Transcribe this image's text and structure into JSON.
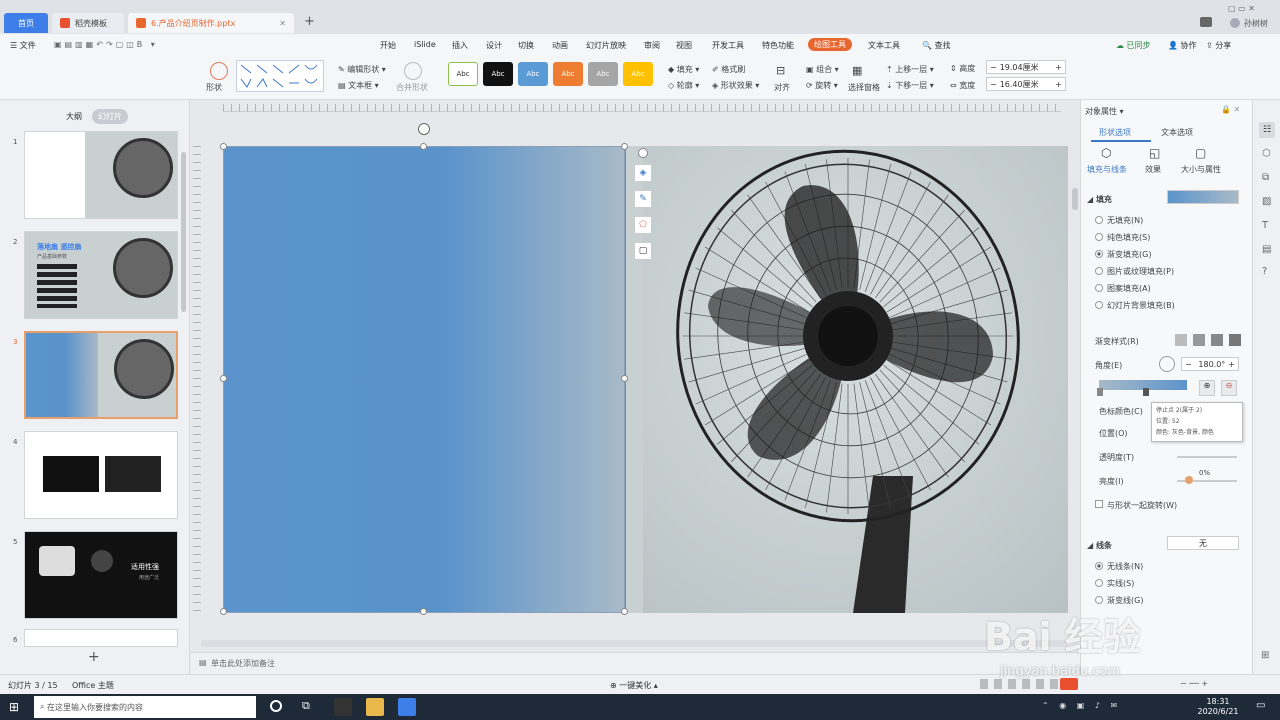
{
  "tabs": {
    "home": "首页",
    "templates": "稻壳模板",
    "document": "6.产品介绍页制作.pptx",
    "user": "孙树树"
  },
  "menu": {
    "file": "文件",
    "items": [
      "开始",
      "iSlide",
      "插入",
      "设计",
      "切换",
      "动画",
      "幻灯片放映",
      "审阅",
      "视图",
      "开发工具",
      "特色功能",
      "绘图工具",
      "文本工具"
    ],
    "active_index": 11,
    "search": "查找",
    "sync": "已同步",
    "collab": "协作",
    "share": "分享"
  },
  "ribbon": {
    "shape_label": "形状",
    "edit_shape": "编辑形状",
    "text_box": "文本框",
    "merge_shape": "合并形状",
    "style_label": "Abc",
    "fill": "填充",
    "format_brush": "格式刷",
    "outline": "轮廓",
    "shape_effect": "形状效果",
    "align": "对齐",
    "group": "组合",
    "rotate": "旋转",
    "select_pane": "选择窗格",
    "up_layer": "上移一层",
    "down_layer": "下移一层",
    "height_label": "高度",
    "width_label": "宽度",
    "height_value": "19.04厘米",
    "width_value": "16.40厘米"
  },
  "styles": [
    {
      "bg": "#ffffff",
      "fg": "#333333",
      "border": "#8bc34a"
    },
    {
      "bg": "#111111",
      "fg": "#ffffff",
      "border": "#111111"
    },
    {
      "bg": "#5b9bd5",
      "fg": "#ffffff",
      "border": "#5b9bd5"
    },
    {
      "bg": "#ed7d31",
      "fg": "#ffffff",
      "border": "#ed7d31"
    },
    {
      "bg": "#a5a5a5",
      "fg": "#ffffff",
      "border": "#a5a5a5"
    },
    {
      "bg": "#ffc000",
      "fg": "#ffffff",
      "border": "#ffc000"
    }
  ],
  "left": {
    "outline_tab": "大纲",
    "slides_tab": "幻灯片",
    "nums": [
      "1",
      "2",
      "3",
      "4",
      "5",
      "6"
    ]
  },
  "thumb2": {
    "title1": "落地扇",
    "title2": "遥控扇",
    "sub": "产品基础参数"
  },
  "thumb5": {
    "title": "适用性强",
    "sub": "用途广泛"
  },
  "notes": "单击此处添加备注",
  "panel": {
    "title": "对象属性",
    "tab_shape": "形状选项",
    "tab_text": "文本选项",
    "sub_fill": "填充与线条",
    "sub_effect": "效果",
    "sub_size": "大小与属性",
    "fill_section": "填充",
    "fill_options": [
      "无填充(N)",
      "纯色填充(S)",
      "渐变填充(G)",
      "图片或纹理填充(P)",
      "图案填充(A)",
      "幻灯片背景填充(B)"
    ],
    "selected_fill_index": 2,
    "gradient_style": "渐变样式(R)",
    "angle_label": "角度(E)",
    "angle_value": "180.0°",
    "color_label": "色标颜色(C)",
    "position_label": "位置(O)",
    "transparency_label": "透明度(T)",
    "brightness_label": "亮度(I)",
    "brightness_value": "0%",
    "rotate_with": "与形状一起旋转(W)",
    "tooltip1": "停止点 2(属于 2)",
    "tooltip2": "位置: 52",
    "tooltip3": "颜色: 灰色-背景, 颜色",
    "line_section": "线条",
    "line_value": "无",
    "line_options": [
      "无线条(N)",
      "实线(S)",
      "渐变线(G)"
    ]
  },
  "status": {
    "slide": "幻灯片 3 / 15",
    "theme": "Office 主题",
    "beautify": "一键美化"
  },
  "taskbar": {
    "search": "在这里输入你要搜索的内容",
    "time": "18:31",
    "date": "2020/6/21"
  },
  "watermark": {
    "text": "Bai  经验",
    "url": "jingyan.baidu.com"
  }
}
